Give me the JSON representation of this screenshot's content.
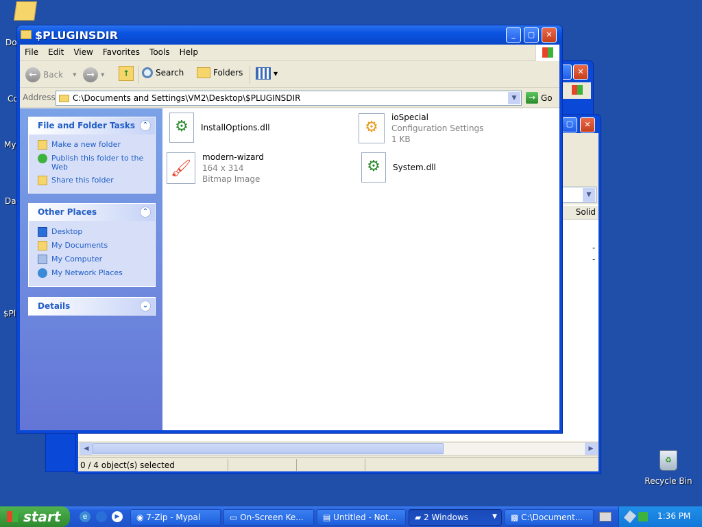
{
  "desktop": {
    "left_labels": [
      "Do",
      "Co",
      "My",
      "Da",
      "$Pl"
    ],
    "recycle_bin": "Recycle Bin"
  },
  "back_window": {
    "column_header": "Solid",
    "row1": "-",
    "row2": "-",
    "status": "0 / 4 object(s) selected"
  },
  "window": {
    "title": "$PLUGINSDIR",
    "menus": [
      "File",
      "Edit",
      "View",
      "Favorites",
      "Tools",
      "Help"
    ],
    "toolbar": {
      "back": "Back",
      "search": "Search",
      "folders": "Folders"
    },
    "address": {
      "label": "Address",
      "value": "C:\\Documents and Settings\\VM2\\Desktop\\$PLUGINSDIR",
      "go": "Go"
    },
    "tasks": {
      "title": "File and Folder Tasks",
      "items": [
        "Make a new folder",
        "Publish this folder to the Web",
        "Share this folder"
      ]
    },
    "places": {
      "title": "Other Places",
      "items": [
        "Desktop",
        "My Documents",
        "My Computer",
        "My Network Places"
      ]
    },
    "details": {
      "title": "Details"
    },
    "files": [
      {
        "name": "InstallOptions.dll",
        "line2": "",
        "line3": ""
      },
      {
        "name": "ioSpecial",
        "line2": "Configuration Settings",
        "line3": "1 KB"
      },
      {
        "name": "modern-wizard",
        "line2": "164 x 314",
        "line3": "Bitmap Image"
      },
      {
        "name": "System.dll",
        "line2": "",
        "line3": ""
      }
    ]
  },
  "taskbar": {
    "start": "start",
    "buttons": [
      "7-Zip - Mypal",
      "On-Screen Ke...",
      "Untitled - Not...",
      "2 Windows",
      "C:\\Document..."
    ],
    "clock": "1:36 PM"
  }
}
